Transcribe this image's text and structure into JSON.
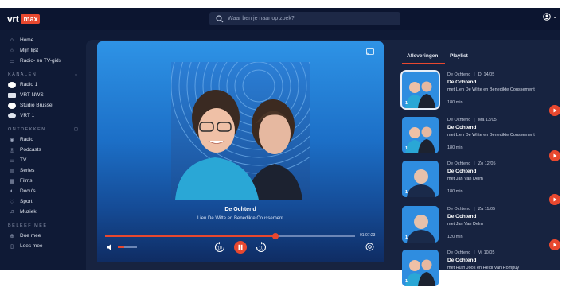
{
  "header": {
    "logo_text": "vrt",
    "logo_badge": "max",
    "search_placeholder": "Waar ben je naar op zoek?",
    "account_caret": "⌄"
  },
  "sidebar": {
    "main": [
      {
        "label": "Home",
        "icon": "home-icon"
      },
      {
        "label": "Mijn lijst",
        "icon": "star-icon"
      },
      {
        "label": "Radio- en TV-gids",
        "icon": "guide-icon"
      }
    ],
    "section_channels": "KANALEN",
    "channels": [
      {
        "label": "Radio 1",
        "icon": "radio1-logo-icon",
        "color": "#ffffff"
      },
      {
        "label": "VRT NWS",
        "icon": "vrtnws-logo-icon",
        "color": "#ffffff"
      },
      {
        "label": "Studio Brussel",
        "icon": "stubru-logo-icon",
        "color": "#ffffff"
      },
      {
        "label": "VRT 1",
        "icon": "vrt1-logo-icon",
        "color": "#ffffff"
      }
    ],
    "section_discover": "ONTDEKKEN",
    "discover": [
      {
        "label": "Radio",
        "icon": "radio-icon"
      },
      {
        "label": "Podcasts",
        "icon": "podcast-icon"
      },
      {
        "label": "TV",
        "icon": "tv-icon"
      },
      {
        "label": "Series",
        "icon": "series-icon"
      },
      {
        "label": "Films",
        "icon": "film-icon"
      },
      {
        "label": "Docu's",
        "icon": "docu-icon"
      },
      {
        "label": "Sport",
        "icon": "sport-icon"
      },
      {
        "label": "Muziek",
        "icon": "music-icon"
      }
    ],
    "section_experience": "BELEEF MEE",
    "experience": [
      {
        "label": "Doe mee",
        "icon": "participate-icon"
      },
      {
        "label": "Lees mee",
        "icon": "read-icon"
      }
    ]
  },
  "player": {
    "title": "De Ochtend",
    "subtitle": "Lien De Witte en Benedikte Coussement",
    "time": "01:07:23",
    "progress": 0.68,
    "volume": 0.35,
    "skip_back": "10",
    "skip_fwd": "10"
  },
  "tabs": [
    {
      "label": "Afleveringen",
      "active": true
    },
    {
      "label": "Playlist",
      "active": false
    }
  ],
  "episodes": [
    {
      "show": "De Ochtend",
      "date": "Di 14/05",
      "title": "De Ochtend",
      "host": "met Lien De Witte en Benedikte Coussement",
      "duration": "180 min",
      "selected": true,
      "num": "1"
    },
    {
      "show": "De Ochtend",
      "date": "Ma 13/05",
      "title": "De Ochtend",
      "host": "met Lien De Witte en Benedikte Coussement",
      "duration": "180 min",
      "selected": false,
      "num": "1"
    },
    {
      "show": "De Ochtend",
      "date": "Zo 12/05",
      "title": "De Ochtend",
      "host": "met Jan Van Delm",
      "duration": "180 min",
      "selected": false,
      "num": "1"
    },
    {
      "show": "De Ochtend",
      "date": "Za 11/05",
      "title": "De Ochtend",
      "host": "met Jan Van Delm",
      "duration": "120 min",
      "selected": false,
      "num": "1"
    },
    {
      "show": "De Ochtend",
      "date": "Vr 10/05",
      "title": "De Ochtend",
      "host": "met Ruth Joos en Heidi Van Rompuy",
      "duration": "",
      "selected": false,
      "num": "1"
    }
  ],
  "colors": {
    "accent": "#e8482f",
    "background": "#0f1a36",
    "player_blue": "#2e93e6"
  }
}
